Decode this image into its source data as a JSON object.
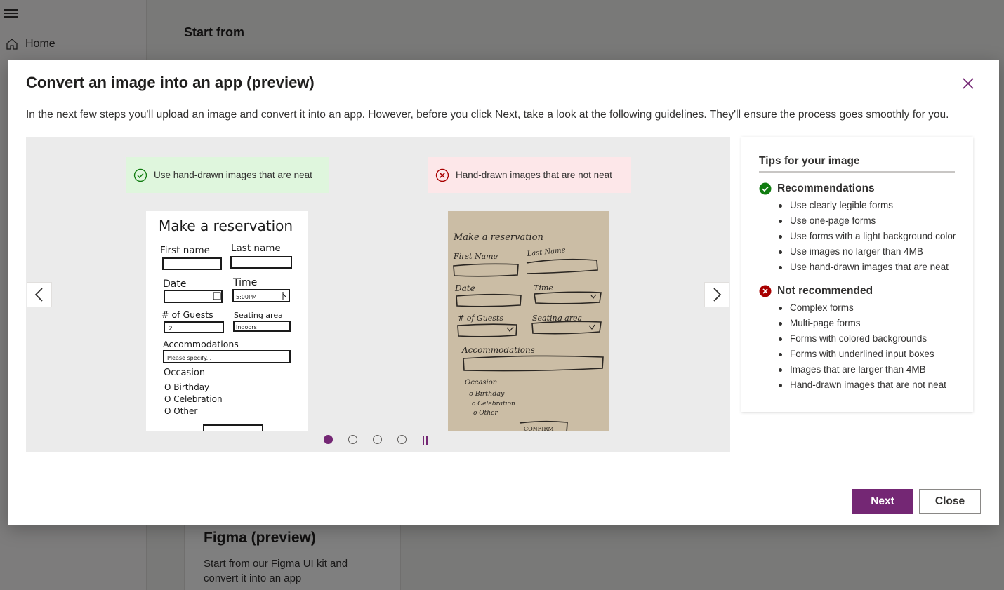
{
  "background": {
    "nav_home_label": "Home",
    "start_from_heading": "Start from",
    "figma_card": {
      "title": "Figma (preview)",
      "description": "Start from our Figma UI kit and convert it into an app"
    }
  },
  "dialog": {
    "title": "Convert an image into an app (preview)",
    "description": "In the next few steps you'll upload an image and convert it into an app. However, before you click Next, take a look at the following guidelines. They'll ensure the process goes smoothly for you.",
    "close_icon": "close-icon"
  },
  "carousel": {
    "good_label": "Use hand-drawn images that are neat",
    "bad_label": "Hand-drawn images that are not neat",
    "good_sketch": {
      "title": "Make a reservation",
      "first_name": "First name",
      "last_name": "Last name",
      "date": "Date",
      "time": "Time",
      "time_value": "5:00PM",
      "guests": "# of Guests",
      "guests_value": "2",
      "seating": "Seating area",
      "seating_value": "Indoors",
      "accommodations": "Accommodations",
      "accommodations_placeholder": "Please specify...",
      "occasion": "Occasion",
      "opt1": "O Birthday",
      "opt2": "O Celebration",
      "opt3": "O Other"
    },
    "bad_sketch": {
      "title": "Make a reservation",
      "first_name": "First Name",
      "last_name": "Last Name",
      "date": "Date",
      "time": "Time",
      "guests": "# of Guests",
      "seating": "Seating area",
      "accommodations": "Accommodations",
      "occasion": "Occasion",
      "opt1": "o Birthday",
      "opt2": "o Celebration",
      "opt3": "o Other",
      "confirm": "CONFIRM"
    },
    "slide_count": 4,
    "active_slide": 1,
    "prev_icon": "chevron-left-icon",
    "next_icon": "chevron-right-icon",
    "pause_icon": "pause-icon"
  },
  "tips": {
    "title": "Tips for your image",
    "recommended": {
      "heading": "Recommendations",
      "items": [
        "Use clearly legible forms",
        "Use one-page forms",
        "Use forms with a light background color",
        "Use images no larger than 4MB",
        "Use hand-drawn images that are neat"
      ]
    },
    "not_recommended": {
      "heading": "Not recommended",
      "items": [
        "Complex forms",
        "Multi-page forms",
        "Forms with colored backgrounds",
        "Forms with underlined input boxes",
        "Images that are larger than 4MB",
        "Hand-drawn images that are not neat"
      ]
    }
  },
  "buttons": {
    "next": "Next",
    "close": "Close"
  },
  "colors": {
    "accent": "#742774",
    "success": "#107c10",
    "error": "#a80000"
  }
}
